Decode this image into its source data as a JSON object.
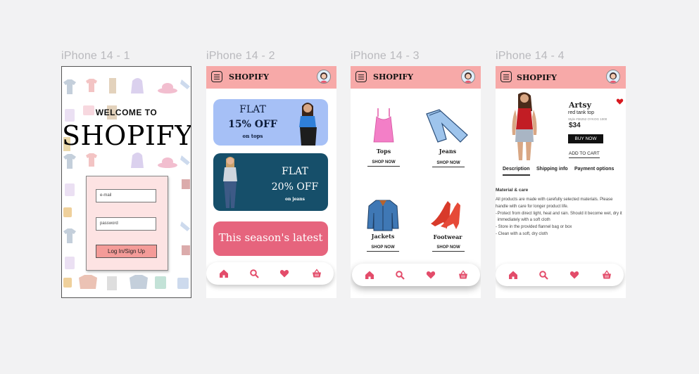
{
  "frames": [
    {
      "label": "iPhone 14 - 1"
    },
    {
      "label": "iPhone 14 - 2"
    },
    {
      "label": "iPhone 14 - 3"
    },
    {
      "label": "iPhone 14 - 4"
    }
  ],
  "brand": "SHOPIFY",
  "login": {
    "welcome": "WELCOME TO",
    "title": "SHOPIFY",
    "email_placeholder": "e-mail",
    "password_placeholder": "password",
    "button": "Log In/Sign Up"
  },
  "home": {
    "banners": [
      {
        "line1": "FLAT",
        "line2": "15% OFF",
        "line3": "on tops",
        "color": "#a6c0f6"
      },
      {
        "line1": "FLAT",
        "line2": "20% OFF",
        "line3": "on jeans",
        "color": "#164f6a"
      },
      {
        "text": "This season's latest",
        "color": "#e6647d"
      }
    ]
  },
  "categories": {
    "items": [
      {
        "name": "Tops",
        "action": "SHOP NOW"
      },
      {
        "name": "Jeans",
        "action": "SHOP NOW"
      },
      {
        "name": "Jackets",
        "action": "SHOP NOW"
      },
      {
        "name": "Footwear",
        "action": "SHOP NOW"
      }
    ]
  },
  "product": {
    "name": "Artsy",
    "subtitle": "red tank top",
    "style": "Style #36252 OYKOG 1000",
    "price": "$34",
    "buy_now": "BUY NOW",
    "add_to_cart": "ADD TO CART",
    "tabs": [
      "Description",
      "Shipping info",
      "Payment options"
    ],
    "section_title": "Material & care",
    "body": "All products are made with carefully selected materials. Please handle with care for longer product life.",
    "bullets": [
      "Protect from direct light, heat and rain. Should it become wet, dry it immediately with a soft cloth",
      "Store in the provided flannel bag or box",
      "Clean with a soft, dry cloth"
    ]
  },
  "nav_icons": [
    "home-icon",
    "search-icon",
    "heart-icon",
    "basket-icon"
  ],
  "colors": {
    "accent": "#f7a9a8",
    "icon": "#e34c6a",
    "background": "#f2f2f3"
  }
}
